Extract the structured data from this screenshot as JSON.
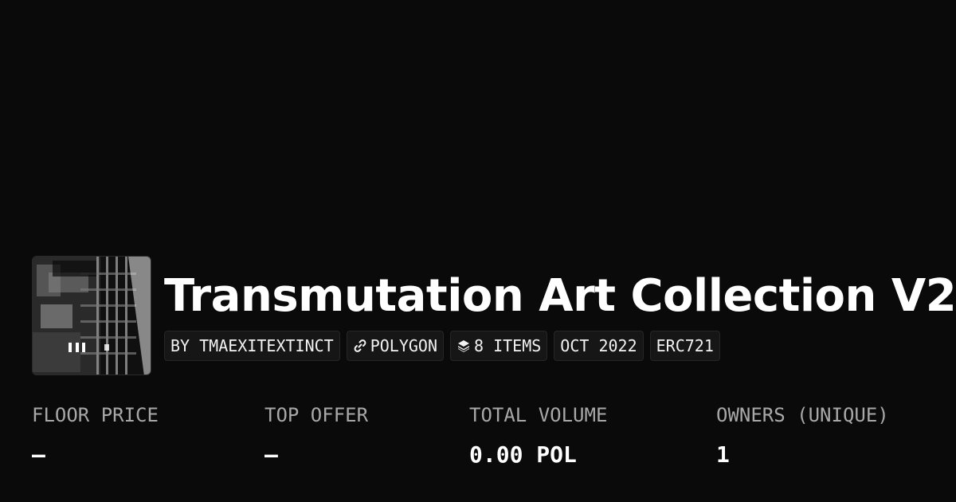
{
  "collection": {
    "title": "Transmutation Art Collection V2",
    "thumbnail_alt": "collection-thumbnail"
  },
  "chips": [
    {
      "label": "BY TMAEXITEXTINCT",
      "icon": ""
    },
    {
      "label": "POLYGON",
      "icon": "chain-link-icon"
    },
    {
      "label": "8 ITEMS",
      "icon": "layers-icon"
    },
    {
      "label": "OCT 2022",
      "icon": ""
    },
    {
      "label": "ERC721",
      "icon": ""
    }
  ],
  "stats": [
    {
      "label": "FLOOR PRICE",
      "value": "–"
    },
    {
      "label": "TOP OFFER",
      "value": "–"
    },
    {
      "label": "TOTAL VOLUME",
      "value": "0.00 POL"
    },
    {
      "label": "OWNERS (UNIQUE)",
      "value": "1"
    }
  ],
  "colors": {
    "background": "#0a0a0a",
    "text": "#ffffff",
    "muted": "#a8a8a8",
    "chip_bg": "#161616"
  }
}
